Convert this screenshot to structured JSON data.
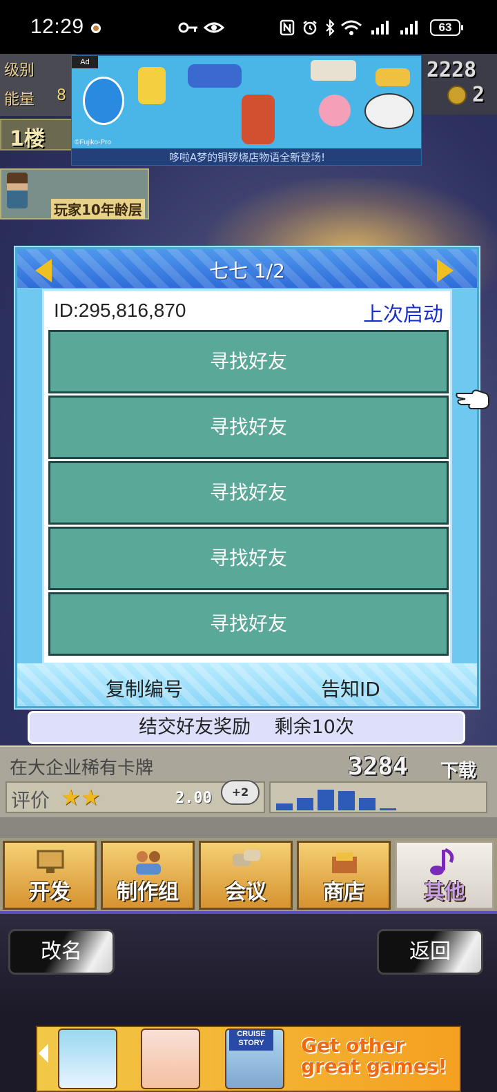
{
  "status_bar": {
    "time": "12:29",
    "battery": "63",
    "icons": [
      "key-icon",
      "eye-icon",
      "nfc-icon",
      "alarm-icon",
      "bluetooth-icon",
      "wifi-icon",
      "signal-icon",
      "signal-icon"
    ]
  },
  "game_hud_top": {
    "level_label": "级别",
    "energy_label": "能量",
    "energy_value": "8",
    "money": "2228",
    "coins": "2",
    "floor_label": "1楼",
    "player_caption": "玩家10年龄层"
  },
  "ad_banner": {
    "tag": "Ad",
    "copyright": "©Fujiko-Pro",
    "caption": "哆啦A梦的铜锣烧店物语全新登场!"
  },
  "friend_dialog": {
    "title": "七七 1/2",
    "id_text": "ID:295,816,870",
    "last_launch_label": "上次启动",
    "slots": [
      "寻找好友",
      "寻找好友",
      "寻找好友",
      "寻找好友",
      "寻找好友"
    ],
    "copy_button": "复制编号",
    "share_id_button": "告知ID"
  },
  "reward_bar": {
    "label": "结交好友奖励",
    "remaining": "剩余10次"
  },
  "hud_bottom": {
    "news": "在大企业稀有卡牌",
    "count": "3284",
    "count_unit": "下载",
    "rating_label": "评价",
    "stars": "★★",
    "rating_score": "2.00",
    "bubble": "+2",
    "graph_bars": [
      0.25,
      0.45,
      0.75,
      0.7,
      0.45,
      0.08
    ]
  },
  "menu_tabs": [
    {
      "label": "开发",
      "icon": "monitor-icon"
    },
    {
      "label": "制作组",
      "icon": "team-icon"
    },
    {
      "label": "会议",
      "icon": "chat-icon"
    },
    {
      "label": "商店",
      "icon": "shop-icon"
    },
    {
      "label": "其他",
      "icon": "music-note-icon"
    }
  ],
  "bottom_buttons": {
    "rename": "改名",
    "back": "返回"
  },
  "promo": {
    "headline": "Get other great games!",
    "cruise_label": "CRUISE STORY"
  },
  "colors": {
    "slot_fill": "#5aa898",
    "dialog_frame": "#6ec8f0",
    "last_launch_text": "#1a2ecc",
    "accent_gold": "#f0c020"
  }
}
